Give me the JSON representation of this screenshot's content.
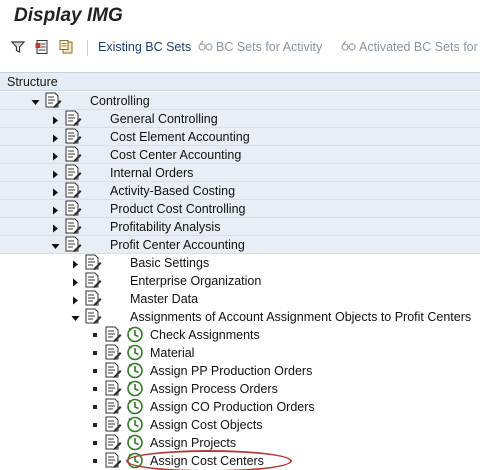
{
  "window": {
    "title": "Display IMG"
  },
  "toolbar": {
    "icons": [
      "filter-icon",
      "documentation-icon",
      "release-notes-icon"
    ],
    "buttons": [
      {
        "label": "Existing BC Sets",
        "state": "active"
      },
      {
        "label": "BC Sets for Activity",
        "state": "disabled"
      },
      {
        "label": "Activated BC Sets for",
        "state": "disabled"
      }
    ]
  },
  "tree": {
    "header": "Structure",
    "nodes": [
      {
        "label": "Controlling",
        "level": 0,
        "expander": "expanded"
      },
      {
        "label": "General Controlling",
        "level": 1,
        "expander": "collapsed"
      },
      {
        "label": "Cost Element Accounting",
        "level": 1,
        "expander": "collapsed"
      },
      {
        "label": "Cost Center Accounting",
        "level": 1,
        "expander": "collapsed"
      },
      {
        "label": "Internal Orders",
        "level": 1,
        "expander": "collapsed"
      },
      {
        "label": "Activity-Based Costing",
        "level": 1,
        "expander": "collapsed"
      },
      {
        "label": "Product Cost Controlling",
        "level": 1,
        "expander": "collapsed"
      },
      {
        "label": "Profitability Analysis",
        "level": 1,
        "expander": "collapsed"
      },
      {
        "label": "Profit Center Accounting",
        "level": 1,
        "expander": "expanded"
      },
      {
        "label": "Basic Settings",
        "level": 2,
        "expander": "collapsed"
      },
      {
        "label": "Enterprise Organization",
        "level": 2,
        "expander": "collapsed"
      },
      {
        "label": "Master Data",
        "level": 2,
        "expander": "collapsed"
      },
      {
        "label": "Assignments of Account Assignment Objects to Profit Centers",
        "level": 2,
        "expander": "expanded"
      },
      {
        "label": "Check Assignments",
        "level": 3,
        "expander": "leaf"
      },
      {
        "label": "Material",
        "level": 3,
        "expander": "leaf"
      },
      {
        "label": "Assign PP Production Orders",
        "level": 3,
        "expander": "leaf"
      },
      {
        "label": "Assign Process Orders",
        "level": 3,
        "expander": "leaf"
      },
      {
        "label": "Assign CO Production Orders",
        "level": 3,
        "expander": "leaf"
      },
      {
        "label": "Assign Cost Objects",
        "level": 3,
        "expander": "leaf"
      },
      {
        "label": "Assign Projects",
        "level": 3,
        "expander": "leaf"
      },
      {
        "label": "Assign Cost Centers",
        "level": 3,
        "expander": "leaf",
        "highlighted": true
      }
    ]
  },
  "colors": {
    "tree_row_blue": "#e7eef5",
    "active_link": "#1d3f70",
    "disabled_text": "#8b96a3",
    "highlight_ring": "#b23a3a",
    "clock_green": "#3f8f2f"
  }
}
